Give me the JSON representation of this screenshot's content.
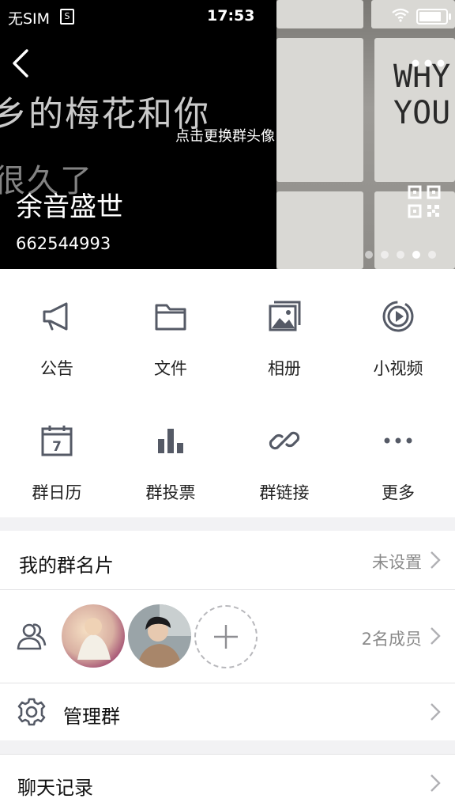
{
  "status_bar": {
    "carrier": "无SIM",
    "sim_glyph": "S",
    "time": "17:53",
    "battery_level": 0.85
  },
  "header": {
    "change_avatar_hint": "点击更换群头像",
    "group_name": "余音盛世",
    "group_id": "662544993",
    "banner_left_text": "乡的梅花和你",
    "banner_left_text_2": "很久了",
    "banner_right_text": "WHY\nYOU",
    "carousel_count": 5,
    "carousel_active_index": 3
  },
  "features": [
    {
      "label": "公告",
      "icon": "megaphone-icon"
    },
    {
      "label": "文件",
      "icon": "folder-icon"
    },
    {
      "label": "相册",
      "icon": "photo-album-icon"
    },
    {
      "label": "小视频",
      "icon": "video-play-icon"
    },
    {
      "label": "群日历",
      "icon": "calendar-icon",
      "icon_text": "7"
    },
    {
      "label": "群投票",
      "icon": "bar-chart-icon"
    },
    {
      "label": "群链接",
      "icon": "link-icon"
    },
    {
      "label": "更多",
      "icon": "more-dots-icon"
    }
  ],
  "my_card": {
    "title": "我的群名片",
    "value": "未设置"
  },
  "members": {
    "count_text": "2名成员"
  },
  "manage": {
    "title": "管理群"
  },
  "chat_history": {
    "title": "聊天记录"
  },
  "colors": {
    "icon_gray": "#555a66",
    "secondary_text": "#8a8a8a",
    "divider": "#e2e2e4",
    "page_bg": "#f2f2f4"
  }
}
